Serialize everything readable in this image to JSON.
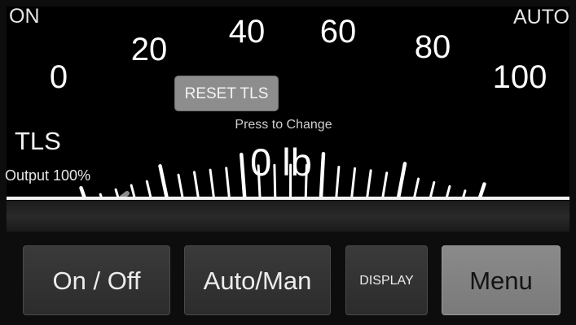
{
  "gauge": {
    "mode_left": "ON",
    "mode_right": "AUTO",
    "scale_labels": [
      "0",
      "20",
      "40",
      "60",
      "80",
      "100"
    ],
    "scale_min": 0,
    "scale_max": 100,
    "needle_value": 0,
    "setpoint_marker_value": 20,
    "tls_label": "TLS",
    "output_label": "Output 100%",
    "reset_button_label": "RESET TLS",
    "press_hint": "Press to Change",
    "reading": "0 lb",
    "colors": {
      "needle": "#8c8c8c",
      "marker": "#666666",
      "ticks": "#ffffff"
    }
  },
  "buttons": {
    "on_off": "On / Off",
    "auto_man": "Auto/Man",
    "display": "DISPLAY",
    "menu": "Menu"
  }
}
